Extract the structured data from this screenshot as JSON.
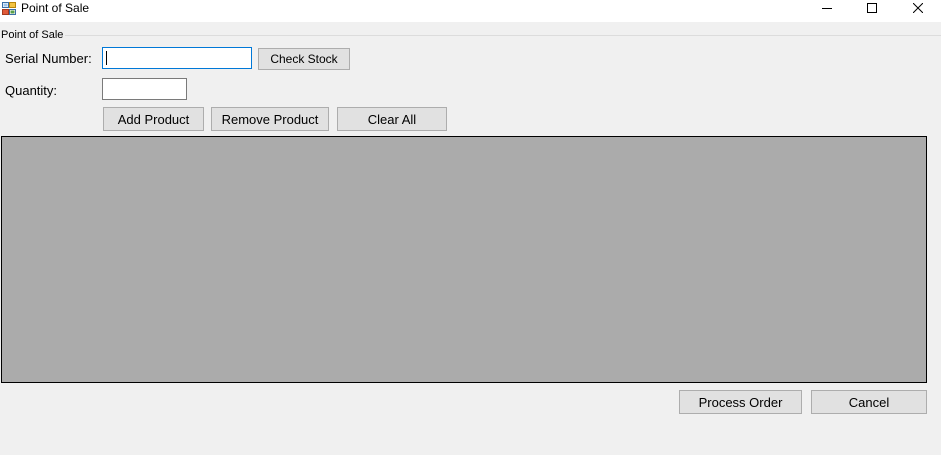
{
  "window": {
    "title": "Point of Sale"
  },
  "group": {
    "label": "Point of Sale"
  },
  "form": {
    "serial_label": "Serial Number:",
    "serial_value": "",
    "quantity_label": "Quantity:",
    "quantity_value": ""
  },
  "buttons": {
    "check_stock": "Check Stock",
    "add_product": "Add Product",
    "remove_product": "Remove Product",
    "clear_all": "Clear All",
    "process_order": "Process Order",
    "cancel": "Cancel"
  },
  "icons": {
    "app": "app-icon",
    "minimize": "minimize-icon",
    "maximize": "maximize-icon",
    "close": "close-icon"
  },
  "colors": {
    "grid_background": "#ababab",
    "focus_border": "#0078d7",
    "button_face": "#e1e1e1"
  }
}
